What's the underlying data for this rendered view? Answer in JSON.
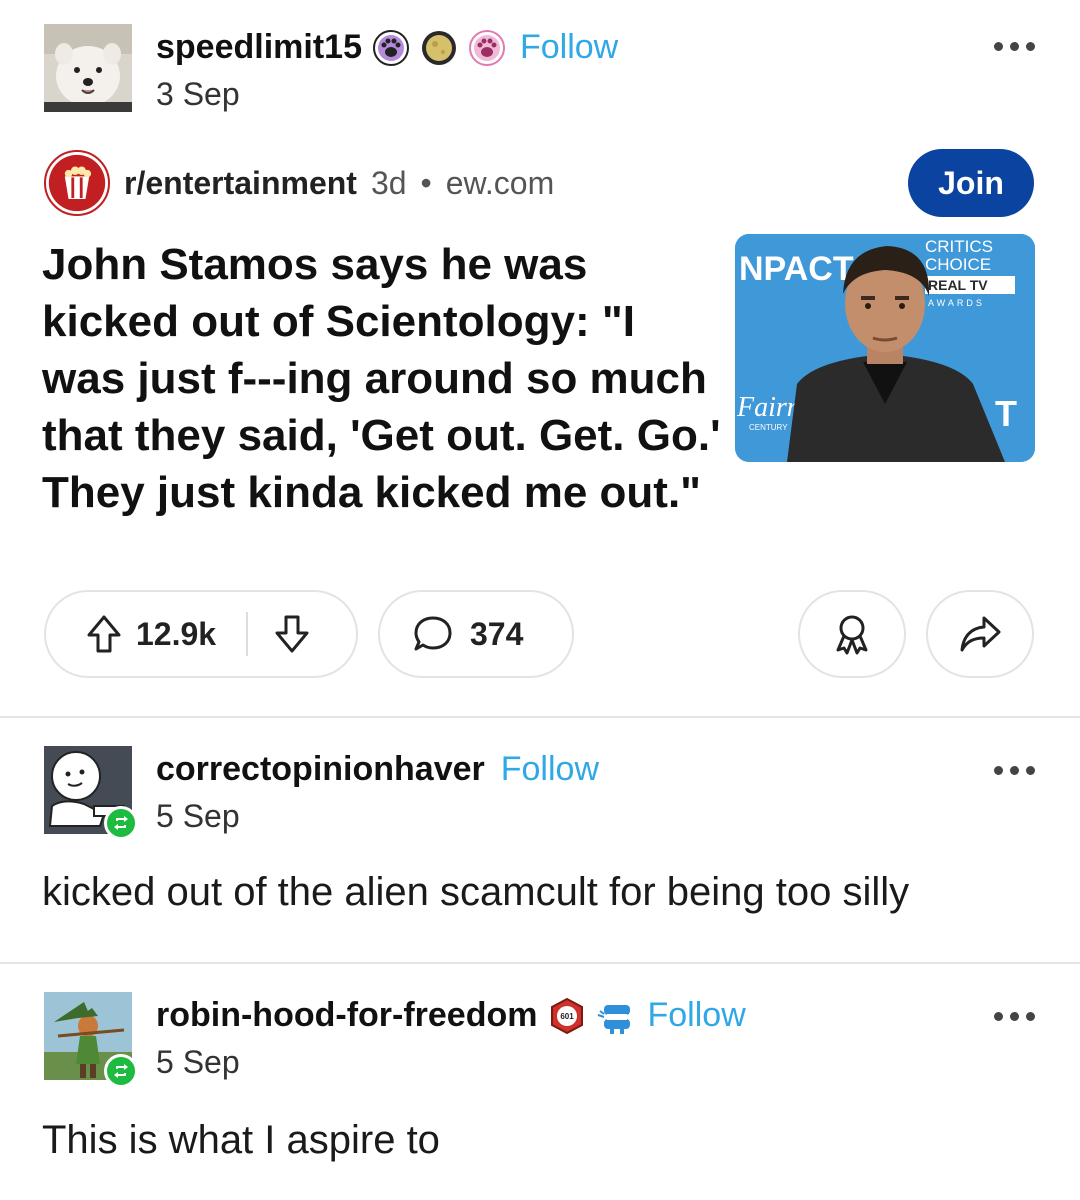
{
  "posts": [
    {
      "username": "speedlimit15",
      "date": "3 Sep",
      "follow_label": "Follow",
      "badges": [
        "paw-badge-icon",
        "moon-badge-icon",
        "paw-badge-pink-icon"
      ],
      "embed": {
        "subreddit": "r/entertainment",
        "age": "3d",
        "separator": "•",
        "domain": "ew.com",
        "join_label": "Join",
        "title": "John Stamos says he was kicked out of Scientology: \"I was just f---ing around so much that they said, 'Get out. Get. Go.' They just kinda kicked me out.\"",
        "upvotes": "12.9k",
        "comments": "374",
        "thumbnail": {
          "logo_text": "NPACT",
          "backdrop_line1": "CRITICS",
          "backdrop_line2": "CHOICE",
          "backdrop_line3": "REAL TV",
          "backdrop_line4": "AWARDS",
          "script_text": "Fairm",
          "small_text": "CENTURY",
          "edge_letter": "T"
        }
      }
    },
    {
      "username": "correctopinionhaver",
      "date": "5 Sep",
      "follow_label": "Follow",
      "text": "kicked out of the alien scamcult for being too silly"
    },
    {
      "username": "robin-hood-for-freedom",
      "date": "5 Sep",
      "follow_label": "Follow",
      "badges": [
        "hexagon-601-badge-icon",
        "wind-up-teeth-badge-icon"
      ],
      "badge_text": "601",
      "text": "This is what I aspire to"
    }
  ],
  "colors": {
    "follow": "#2fa8e6",
    "join_button": "#0a44a0",
    "reblog_badge": "#1dbb3f",
    "subreddit_icon": "#c21f23"
  }
}
